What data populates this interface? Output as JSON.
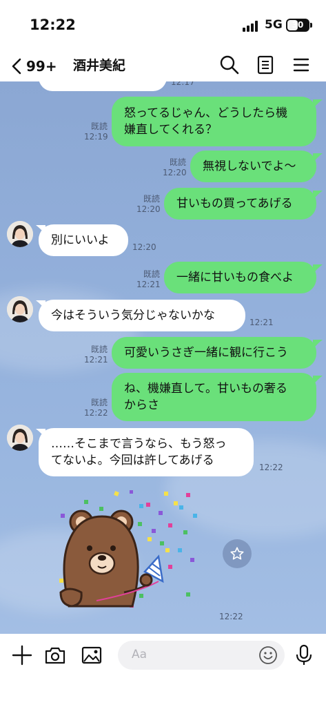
{
  "status_bar": {
    "time": "12:22",
    "network": "5G",
    "battery": "30"
  },
  "header": {
    "back_count": "99+",
    "title": "酒井美紀"
  },
  "messages": [
    {
      "side": "out",
      "text_line1": "怒ってるじゃん、どうしたら機",
      "text_line2": "嫌直してくれる？",
      "read": "既読",
      "time": "12:19"
    },
    {
      "side": "out",
      "text": "無視しないでよ〜",
      "read": "既読",
      "time": "12:20"
    },
    {
      "side": "out",
      "text": "甘いもの買ってあげる",
      "read": "既読",
      "time": "12:20"
    },
    {
      "side": "in",
      "text": "別にいいよ",
      "time": "12:20"
    },
    {
      "side": "out",
      "text": "一緒に甘いもの食べよ",
      "read": "既読",
      "time": "12:21"
    },
    {
      "side": "in",
      "text": "今はそういう気分じゃないかな",
      "time": "12:21"
    },
    {
      "side": "out",
      "text": "可愛いうさぎ一緒に観に行こう",
      "read": "既読",
      "time": "12:21"
    },
    {
      "side": "out",
      "text_line1": "ね、機嫌直して。甘いもの奢る",
      "text_line2": "からさ",
      "read": "既読",
      "time": "12:22"
    },
    {
      "side": "in",
      "text_line1": "……そこまで言うなら、もう怒っ",
      "text_line2": "てないよ。今回は許してあげる",
      "time": "12:22"
    },
    {
      "side": "in",
      "type": "sticker",
      "sticker": "brown-bear-party-popper",
      "time": "12:22"
    }
  ],
  "partial_top_time": "12:17",
  "input": {
    "placeholder": "Aa"
  },
  "icons": {
    "back": "chevron-left-icon",
    "search": "search-icon",
    "notes": "notes-icon",
    "menu": "menu-icon",
    "plus": "plus-icon",
    "camera": "camera-icon",
    "image": "image-icon",
    "emoji": "emoji-icon",
    "mic": "mic-icon",
    "star": "star-icon"
  },
  "colors": {
    "outgoing_bubble": "#6ae07a",
    "incoming_bubble": "#ffffff",
    "chat_background": "#8ba7d3"
  }
}
